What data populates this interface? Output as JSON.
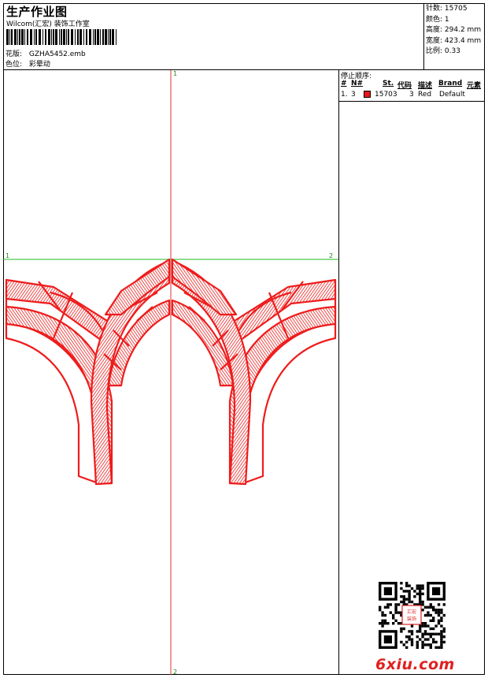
{
  "header": {
    "title": "生产作业图",
    "company": "Wilcom(汇宏) 装饰工作室",
    "pattern_label": "花版:",
    "pattern_value": "GZHA5452.emb",
    "color_label": "色位:",
    "color_value": "彩晕动"
  },
  "stats": {
    "stitches_label": "针数:",
    "stitches_value": "15705",
    "colors_label": "颜色:",
    "colors_value": "1",
    "height_label": "高度:",
    "height_value": "294.2 mm",
    "width_label": "宽度:",
    "width_value": "423.4 mm",
    "scale_label": "比例:",
    "scale_value": "0.33"
  },
  "stop_sequence": {
    "heading": "停止顺序:",
    "columns": [
      "#",
      "N#",
      "St.",
      "代码",
      "描述",
      "Brand",
      "元素"
    ],
    "rows": [
      {
        "index": "1.",
        "needle": "3",
        "swatch_color": "#e8161d",
        "stitches": "15703",
        "code": "3",
        "description": "Red",
        "brand": "Default"
      }
    ]
  },
  "design": {
    "axis_labels": {
      "top": "1",
      "bottom": "2",
      "left": "1",
      "right": "2"
    },
    "thread_color": "#ee1c1c",
    "axis_v_color": "#e23030",
    "axis_h_color": "#22bb22"
  },
  "watermark": {
    "text": "6xiu.com",
    "qr_stamp": "汇宏装饰"
  }
}
